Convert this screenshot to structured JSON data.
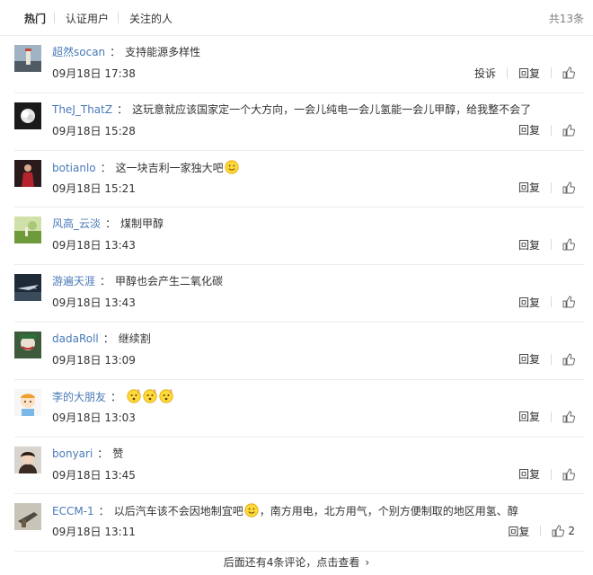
{
  "tabs": [
    {
      "label": "热门",
      "active": true
    },
    {
      "label": "认证用户",
      "active": false
    },
    {
      "label": "关注的人",
      "active": false
    }
  ],
  "total": "共13条",
  "comments": [
    {
      "user": "超然socan",
      "text": "支持能源多样性",
      "time": "09月18日 17:38",
      "report": "投诉",
      "reply": "回复",
      "likes": "",
      "avatar": "avatar-lighthouse"
    },
    {
      "user": "TheJ_ThatZ",
      "text": "这玩意就应该国家定一个大方向，一会儿纯电一会儿氢能一会儿甲醇，给我整不会了",
      "time": "09月18日 15:28",
      "reply": "回复",
      "likes": "",
      "avatar": "avatar-flower"
    },
    {
      "user": "botianlo",
      "text": "这一块吉利一家独大吧",
      "emoji_after": "smile",
      "time": "09月18日 15:21",
      "reply": "回复",
      "likes": "",
      "avatar": "avatar-red-figure"
    },
    {
      "user": "风高_云淡",
      "text": "煤制甲醇",
      "time": "09月18日 13:43",
      "reply": "回复",
      "likes": "",
      "avatar": "avatar-meadow"
    },
    {
      "user": "游遍天涯",
      "text": "甲醇也会产生二氧化碳",
      "time": "09月18日 13:43",
      "reply": "回复",
      "likes": "",
      "avatar": "avatar-plane"
    },
    {
      "user": "dadaRoll",
      "text": "继续割",
      "time": "09月18日 13:09",
      "reply": "回复",
      "likes": "",
      "avatar": "avatar-joker"
    },
    {
      "user": "李的大朋友",
      "text": "",
      "emojis": [
        "question",
        "question",
        "question"
      ],
      "time": "09月18日 13:03",
      "reply": "回复",
      "likes": "",
      "avatar": "avatar-cartoon"
    },
    {
      "user": "bonyari",
      "text": "赞",
      "time": "09月18日 13:45",
      "reply": "回复",
      "likes": "",
      "avatar": "avatar-girl"
    },
    {
      "user": "ECCM-1",
      "text": "以后汽车该不会因地制宜吧",
      "emoji_mid": "smile",
      "text2": "，南方用电，北方用气，个别方便制取的地区用氢、醇",
      "time": "09月18日 13:11",
      "reply": "回复",
      "likes": "2",
      "avatar": "avatar-gun"
    }
  ],
  "more": {
    "label": "后面还有4条评论，点击查看",
    "chevron": "›"
  },
  "colors": {
    "link": "#4a7ab8",
    "text": "#333333",
    "muted": "#808080",
    "divider": "#ececec"
  }
}
